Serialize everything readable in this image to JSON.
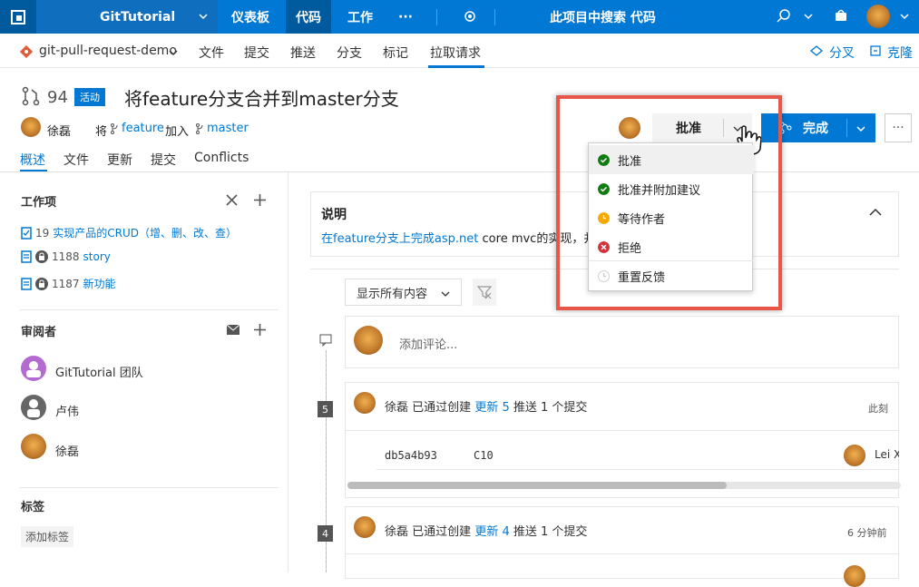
{
  "topbar": {
    "project": "GitTutorial",
    "nav": [
      "仪表板",
      "代码",
      "工作"
    ],
    "more": "···",
    "search_placeholder": "此项目中搜索 代码"
  },
  "subbar": {
    "repo": "git-pull-request-demo",
    "items": [
      "文件",
      "提交",
      "推送",
      "分支",
      "标记",
      "拉取请求"
    ],
    "fork": "分叉",
    "clone": "克隆"
  },
  "pr": {
    "number": "94",
    "status": "活动",
    "title": "将feature分支合并到master分支",
    "author": "徐磊",
    "merge_prefix": "将",
    "source": "feature",
    "merge_mid": "加入",
    "target": "master",
    "tabs": [
      "概述",
      "文件",
      "更新",
      "提交",
      "Conflicts"
    ]
  },
  "actions": {
    "approve": "批准",
    "complete": "完成",
    "more": "···"
  },
  "vote_menu": {
    "items": [
      "批准",
      "批准并附加建议",
      "等待作者",
      "拒绝",
      "重置反馈"
    ]
  },
  "colors": {
    "accent": "#0078d4",
    "approve": "#107c10",
    "wait": "#f7a800",
    "reject": "#d13438",
    "highlight": "#e8564a"
  },
  "left": {
    "workitems_title": "工作项",
    "workitems": [
      {
        "id": "19",
        "title": "实现产品的CRUD（增、删、改、查）"
      },
      {
        "id": "1188",
        "title": "story"
      },
      {
        "id": "1187",
        "title": "新功能"
      }
    ],
    "reviewers_title": "审阅者",
    "reviewers": [
      "GitTutorial 团队",
      "卢伟",
      "徐磊"
    ],
    "tags_title": "标签",
    "add_tag": "添加标签"
  },
  "main": {
    "desc_title": "说明",
    "desc_link": "在feature分支上完成asp.net",
    "desc_rest": " core mvc的实现，并",
    "filter_label": "显示所有内容",
    "comment_placeholder": "添加评论...",
    "updates": [
      {
        "num": "5",
        "author": "徐磊",
        "text1": "已通过创建",
        "link": "更新 5",
        "text2": "推送 1 个提交",
        "time": "此刻",
        "commit_id": "db5a4b93",
        "commit_msg": "C10",
        "commit_author": "Lei X"
      },
      {
        "num": "4",
        "author": "徐磊",
        "text1": "已通过创建",
        "link": "更新 4",
        "text2": "推送 1 个提交",
        "time": "6 分钟前"
      }
    ]
  }
}
